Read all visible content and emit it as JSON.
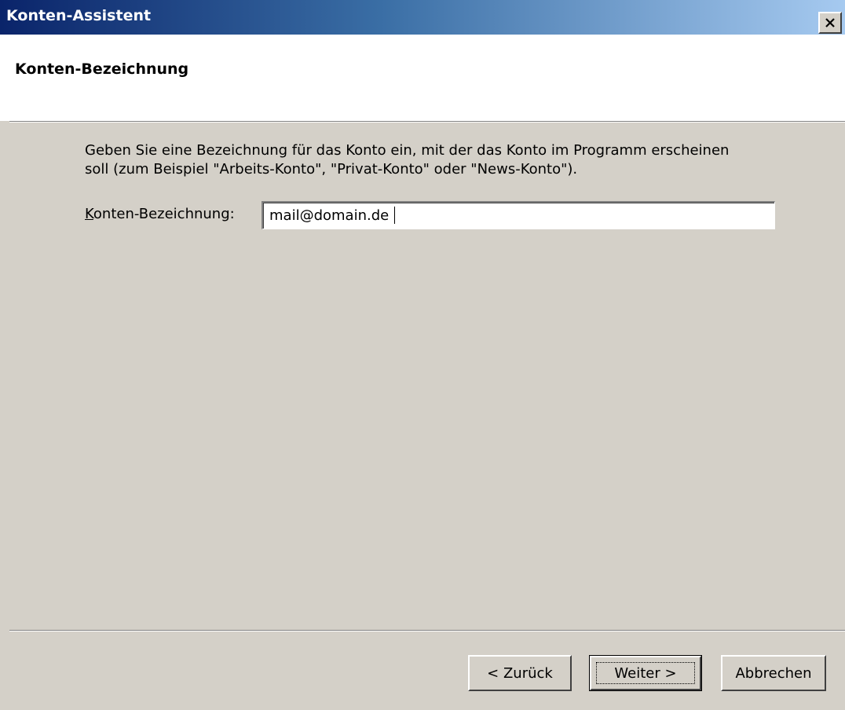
{
  "window": {
    "title": "Konten-Assistent",
    "close_icon": "close-icon"
  },
  "header": {
    "title": "Konten-Bezeichnung"
  },
  "main": {
    "description_line1": "Geben Sie eine Bezeichnung für das Konto ein, mit der das Konto im Programm erscheinen",
    "description_line2": "soll (zum Beispiel \"Arbeits-Konto\", \"Privat-Konto\" oder \"News-Konto\").",
    "field": {
      "label_mnemonic": "K",
      "label_rest": "onten-Bezeichnung:",
      "value": "mail@domain.de"
    }
  },
  "buttons": {
    "back": "< Zurück",
    "next": "Weiter >",
    "cancel": "Abbrechen"
  },
  "colors": {
    "titlebar_start": "#0a246a",
    "titlebar_end": "#a6caf0",
    "dialog_face": "#d4d0c8"
  }
}
